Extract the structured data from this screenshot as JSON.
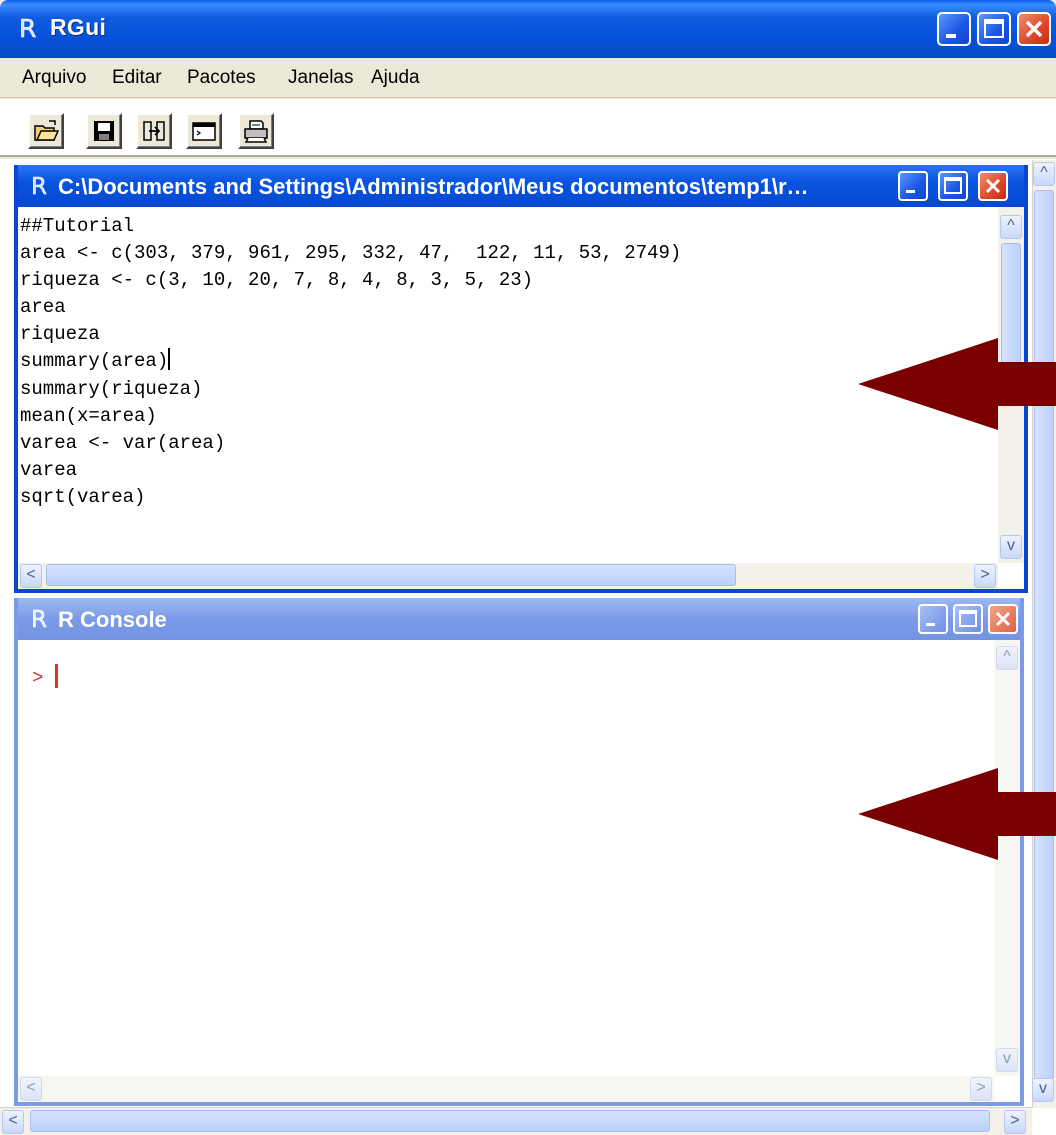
{
  "app": {
    "title": "RGui"
  },
  "menu": [
    "Arquivo",
    "Editar",
    "Pacotes",
    "Janelas",
    "Ajuda"
  ],
  "toolbar": [
    {
      "icon": "open-folder-icon"
    },
    {
      "icon": "save-disk-icon"
    },
    {
      "icon": "load-workspace-icon"
    },
    {
      "icon": "console-window-icon"
    },
    {
      "icon": "print-icon"
    }
  ],
  "script_window": {
    "title": "C:\\Documents and Settings\\Administrador\\Meus documentos\\temp1\\r…",
    "lines": [
      "##Tutorial",
      "area <- c(303, 379, 961, 295, 332, 47,  122, 11, 53, 2749)",
      "riqueza <- c(3, 10, 20, 7, 8, 4, 8, 3, 5, 23)",
      "area",
      "riqueza",
      "summary(area)",
      "summary(riqueza)",
      "mean(x=area)",
      "varea <- var(area)",
      "varea",
      "sqrt(varea)"
    ],
    "cursor_line": 5
  },
  "console_window": {
    "title": "R Console",
    "prompt": ">"
  },
  "colors": {
    "title_active": "#0a54e0",
    "title_inactive": "#7b9be8",
    "arrow": "#7a0000",
    "prompt": "#e0302a"
  }
}
